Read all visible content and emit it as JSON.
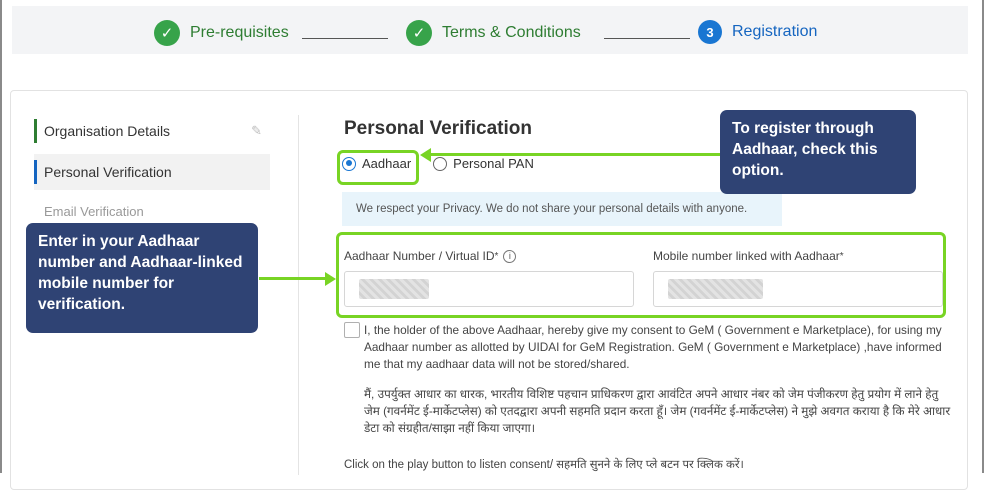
{
  "stepper": {
    "steps": [
      {
        "label": "Pre-requisites",
        "status": "complete"
      },
      {
        "label": "Terms & Conditions",
        "status": "complete"
      },
      {
        "label": "Registration",
        "number": "3",
        "status": "active"
      }
    ]
  },
  "sidebar": {
    "items": [
      {
        "label": "Organisation Details"
      },
      {
        "label": "Personal Verification"
      },
      {
        "label": "Email Verification"
      }
    ]
  },
  "main": {
    "title": "Personal Verification",
    "radio_options": [
      {
        "label": "Aadhaar",
        "selected": true
      },
      {
        "label": "Personal PAN",
        "selected": false
      }
    ],
    "privacy_notice": "We respect your Privacy. We do not share your personal details with anyone.",
    "aadhaar_field_label": "Aadhaar Number / Virtual ID",
    "mobile_field_label": "Mobile number linked with Aadhaar",
    "required_mark": "*",
    "consent_en": "I, the holder of the above Aadhaar, hereby give my consent to GeM ( Government e Marketplace), for using my Aadhaar number as allotted by UIDAI for GeM Registration. GeM ( Government e Marketplace) ,have informed me that my aadhaar data will not be stored/shared.",
    "consent_hi": "मैं, उपर्युक्त आधार का धारक, भारतीय विशिष्ट पहचान प्राधिकरण द्वारा आवंटित अपने आधार नंबर को जेम पंजीकरण हेतु प्रयोग में लाने हेतु जेम (गवर्नमेंट ई-मार्केटप्लेस) को एतदद्वारा अपनी सहमति प्रदान करता हूँ। जेम (गवर्नमेंट ई-मार्केटप्लेस) ने मुझे अवगत कराया है कि मेरे आधार डेटा को संग्रहीत/साझा नहीं किया जाएगा।",
    "play_line": "Click on the play button to listen consent/ सहमति सुनने के लिए प्ले बटन पर क्लिक करें।"
  },
  "annotations": {
    "callout_right": "To register through Aadhaar, check this option.",
    "callout_left": "Enter in your Aadhaar number and Aadhaar-linked mobile number for verification."
  },
  "colors": {
    "step_complete": "#37a34a",
    "step_active": "#1976d2",
    "callout_bg": "#2f4374",
    "highlight": "#78d424"
  }
}
